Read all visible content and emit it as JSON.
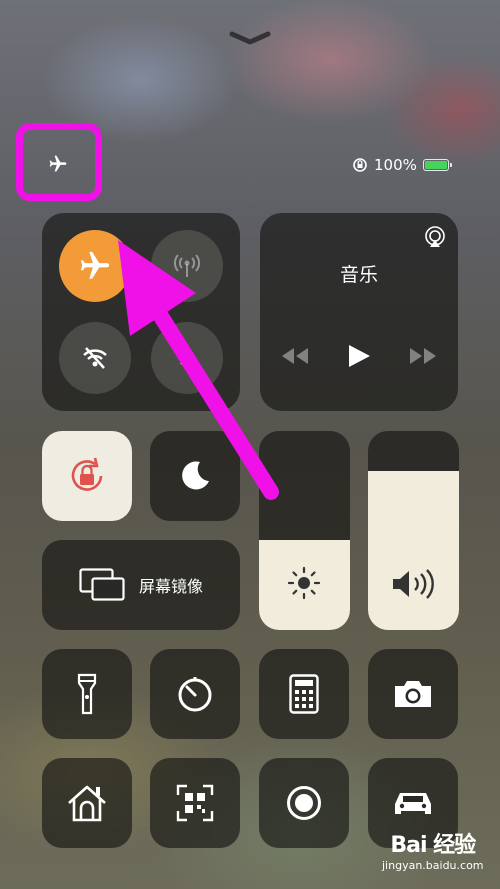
{
  "status": {
    "battery_text": "100%",
    "battery_level": 1.0
  },
  "connectivity": {
    "airplane_mode": true,
    "cellular_data": false,
    "wifi": false,
    "bluetooth": false
  },
  "music": {
    "title": "音乐"
  },
  "orientation_lock": true,
  "do_not_disturb": false,
  "screen_mirroring": {
    "label": "屏幕镜像"
  },
  "brightness": {
    "level": 0.45
  },
  "volume": {
    "level": 0.8
  },
  "accent_color": "#f29b38",
  "annotation_color": "#f010e8",
  "watermark": {
    "brand": "Bai 经验",
    "url": "jingyan.baidu.com"
  }
}
